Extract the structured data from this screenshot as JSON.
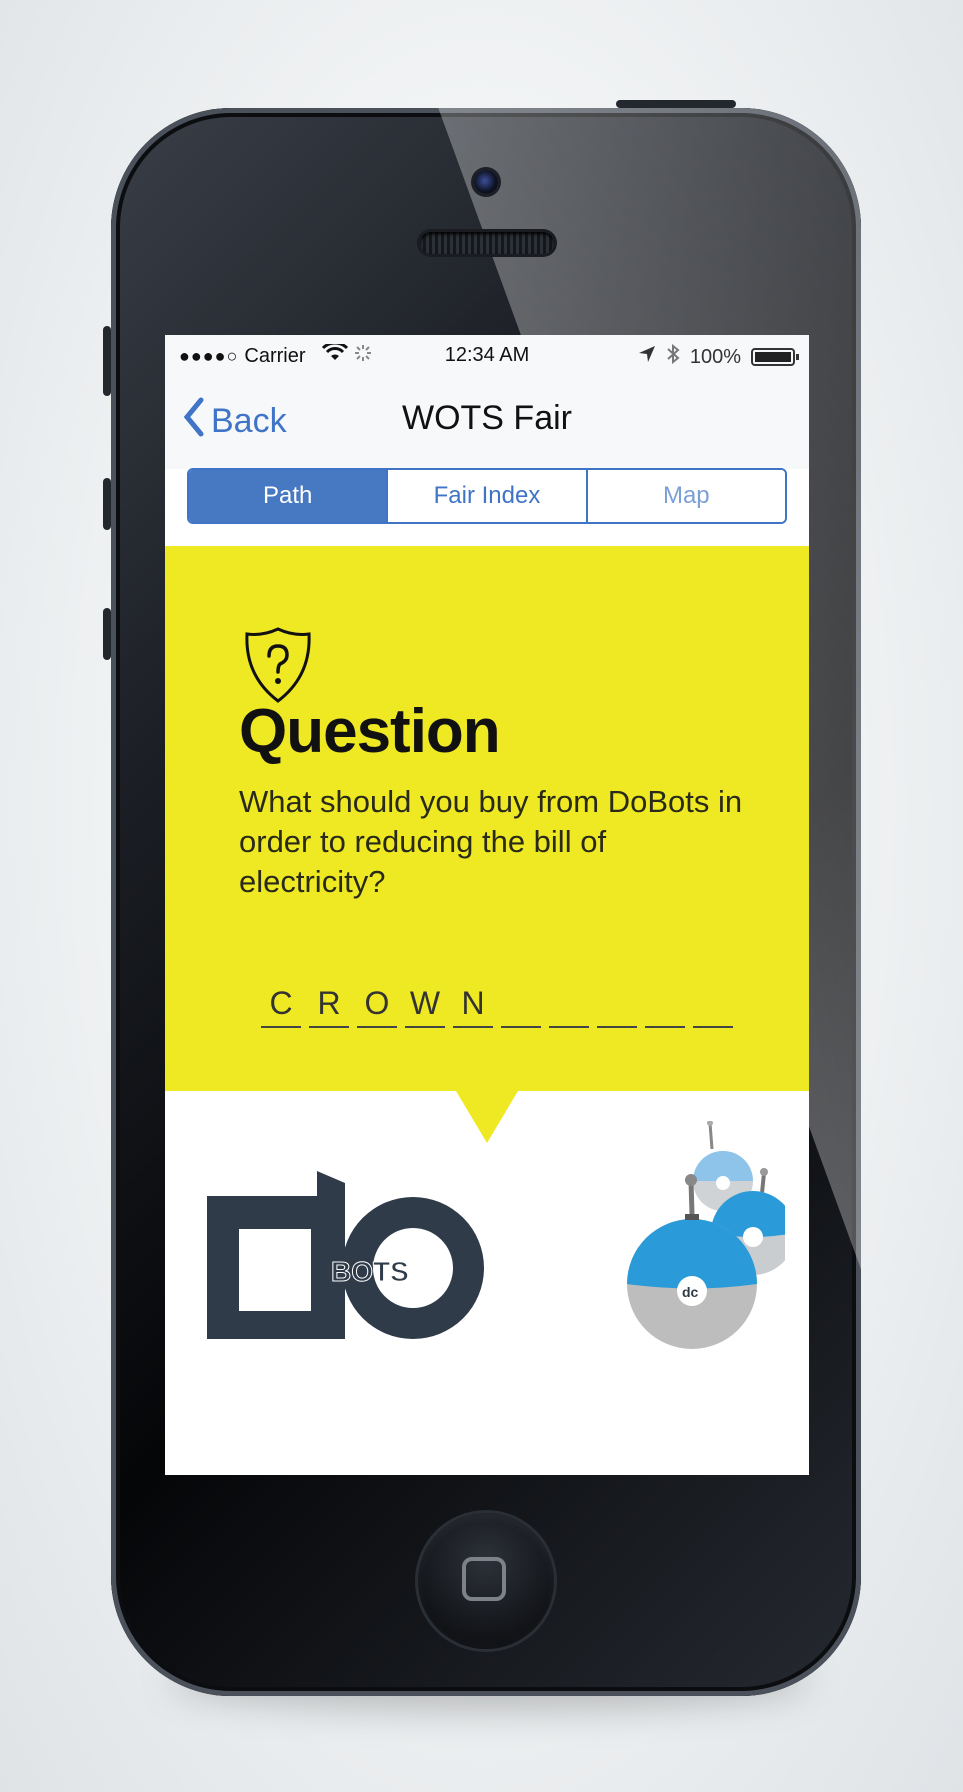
{
  "status_bar": {
    "signal": "●●●●○",
    "carrier": "Carrier",
    "time": "12:34 AM",
    "battery": "100%"
  },
  "nav": {
    "back_label": "Back",
    "title": "WOTS Fair"
  },
  "tabs": [
    {
      "label": "Path",
      "active": true
    },
    {
      "label": "Fair Index",
      "active": false
    },
    {
      "label": "Map",
      "active": false
    }
  ],
  "question": {
    "title": "Question",
    "text": "What should you buy from DoBots in order to reducing the bill of electricity?"
  },
  "answer": {
    "letters": [
      "C",
      "R",
      "O",
      "W",
      "N",
      "",
      "",
      "",
      "",
      ""
    ]
  },
  "logo": {
    "text": "BOTS"
  },
  "colors": {
    "accent": "#4778c2",
    "panel": "#efe923",
    "logo": "#2f3b48",
    "bot_blue": "#2a9ad8"
  }
}
